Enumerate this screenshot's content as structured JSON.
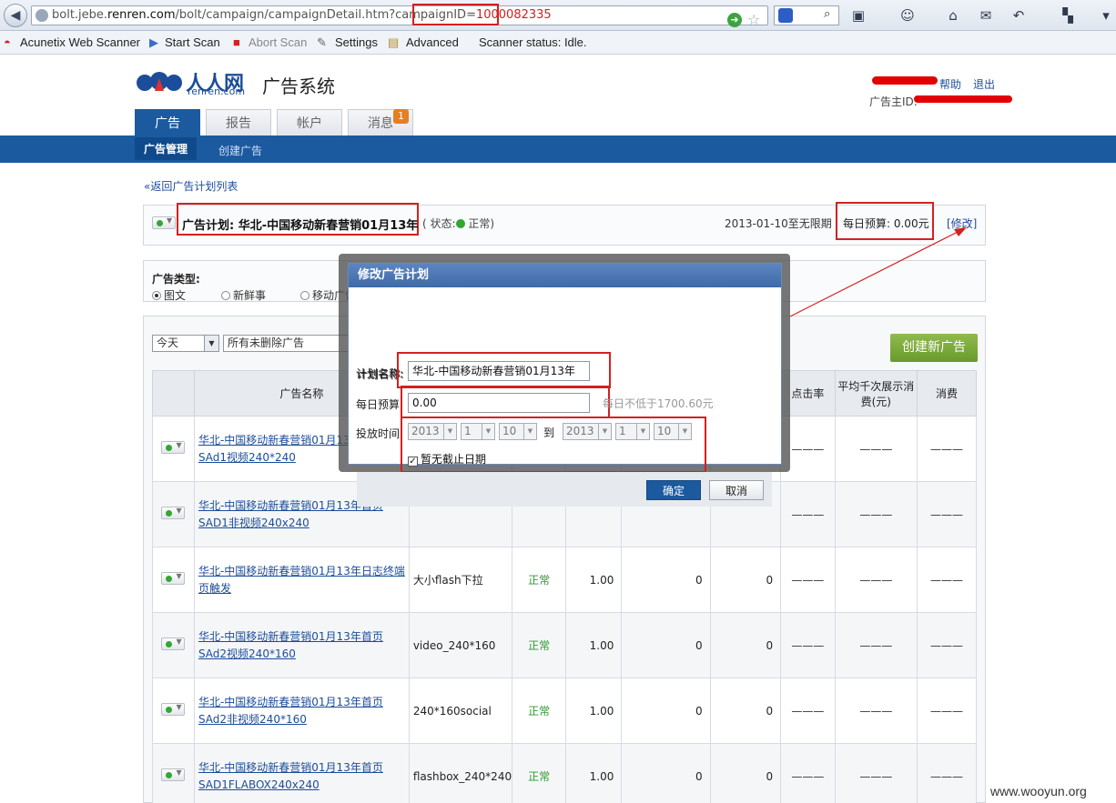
{
  "browser": {
    "url_prefix": "bolt.jebe.",
    "url_domain": "renren.com",
    "url_path": "/bolt/campaign/campaignDetail.htm?campaignID=",
    "url_id": "1000082335"
  },
  "extensions": {
    "acunetix": "Acunetix Web Scanner",
    "start_scan": "Start Scan",
    "abort_scan": "Abort Scan",
    "settings": "Settings",
    "advanced": "Advanced",
    "status": "Scanner status: Idle."
  },
  "header": {
    "logo_cn": "人人网",
    "logo_en": "renren.com",
    "system_title": "广告系统",
    "help_link": "帮助",
    "logout_link": "退出",
    "advertiser_id_label": "广告主ID:"
  },
  "tabs": [
    {
      "label": "广告"
    },
    {
      "label": "报告"
    },
    {
      "label": "帐户"
    },
    {
      "label": "消息"
    }
  ],
  "badge_count": "1",
  "subnav": {
    "active": "广告管理",
    "create": "创建广告"
  },
  "back_link": "«返回广告计划列表",
  "campaign": {
    "name": "广告计划: 华北-中国移动新春营销01月13年",
    "status_prefix": "( 状态:",
    "status_text": "正常",
    "status_suffix": ")",
    "period": "2013-01-10至无限期",
    "budget": "每日预算: 0.00元",
    "modify": "[修改]"
  },
  "ad_type": {
    "label": "广告类型:",
    "options": [
      "图文",
      "新鲜事",
      "移动广告"
    ]
  },
  "filters": {
    "date": "今天",
    "status": "所有未删除广告"
  },
  "create_ad_button": "创建新广告",
  "table": {
    "headers": {
      "name": "广告名称",
      "ctr": "点击率",
      "cpm": "平均千次展示消费(元)",
      "cost": "消费"
    },
    "rows": [
      {
        "name": "华北-中国移动新春营销01月13年首页SAd1视频240*240",
        "type": "",
        "status": "",
        "bid": "",
        "impressions": "",
        "clicks": "",
        "ctr": "———",
        "cpm": "———",
        "cost": "———"
      },
      {
        "name": "华北-中国移动新春营销01月13年首页SAD1非视频240x240",
        "type": "",
        "status": "",
        "bid": "",
        "impressions": "",
        "clicks": "",
        "ctr": "———",
        "cpm": "———",
        "cost": "———"
      },
      {
        "name": "华北-中国移动新春营销01月13年日志终端页触发",
        "type": "大小flash下拉",
        "status": "正常",
        "bid": "1.00",
        "impressions": "0",
        "clicks": "0",
        "ctr": "———",
        "cpm": "———",
        "cost": "———"
      },
      {
        "name": "华北-中国移动新春营销01月13年首页SAd2视频240*160",
        "type": "video_240*160",
        "status": "正常",
        "bid": "1.00",
        "impressions": "0",
        "clicks": "0",
        "ctr": "———",
        "cpm": "———",
        "cost": "———"
      },
      {
        "name": "华北-中国移动新春营销01月13年首页SAd2非视频240*160",
        "type": "240*160social",
        "status": "正常",
        "bid": "1.00",
        "impressions": "0",
        "clicks": "0",
        "ctr": "———",
        "cpm": "———",
        "cost": "———"
      },
      {
        "name": "华北-中国移动新春营销01月13年首页SAD1FLABOX240x240",
        "type": "flashbox_240*240",
        "status": "正常",
        "bid": "1.00",
        "impressions": "0",
        "clicks": "0",
        "ctr": "———",
        "cpm": "———",
        "cost": "———"
      }
    ]
  },
  "dialog": {
    "title": "修改广告计划",
    "plan_name_label": "计划名称:",
    "plan_name_value": "华北-中国移动新春营销01月13年",
    "budget_label": "每日预算:",
    "budget_value": "0.00",
    "budget_hint": "每日不低于1700.60元",
    "period_label": "投放时间:",
    "start_year": "2013",
    "start_month": "1",
    "start_day": "10",
    "to_label": "到",
    "end_year": "2013",
    "end_month": "1",
    "end_day": "10",
    "no_end_label": "暂无截止日期",
    "ok": "确定",
    "cancel": "取消"
  },
  "watermark": "www.wooyun.org",
  "colors": {
    "brand_blue": "#1c5aa0",
    "highlight_red": "#d42020",
    "create_green": "#7aa83a",
    "status_green": "#2f9a2f"
  }
}
